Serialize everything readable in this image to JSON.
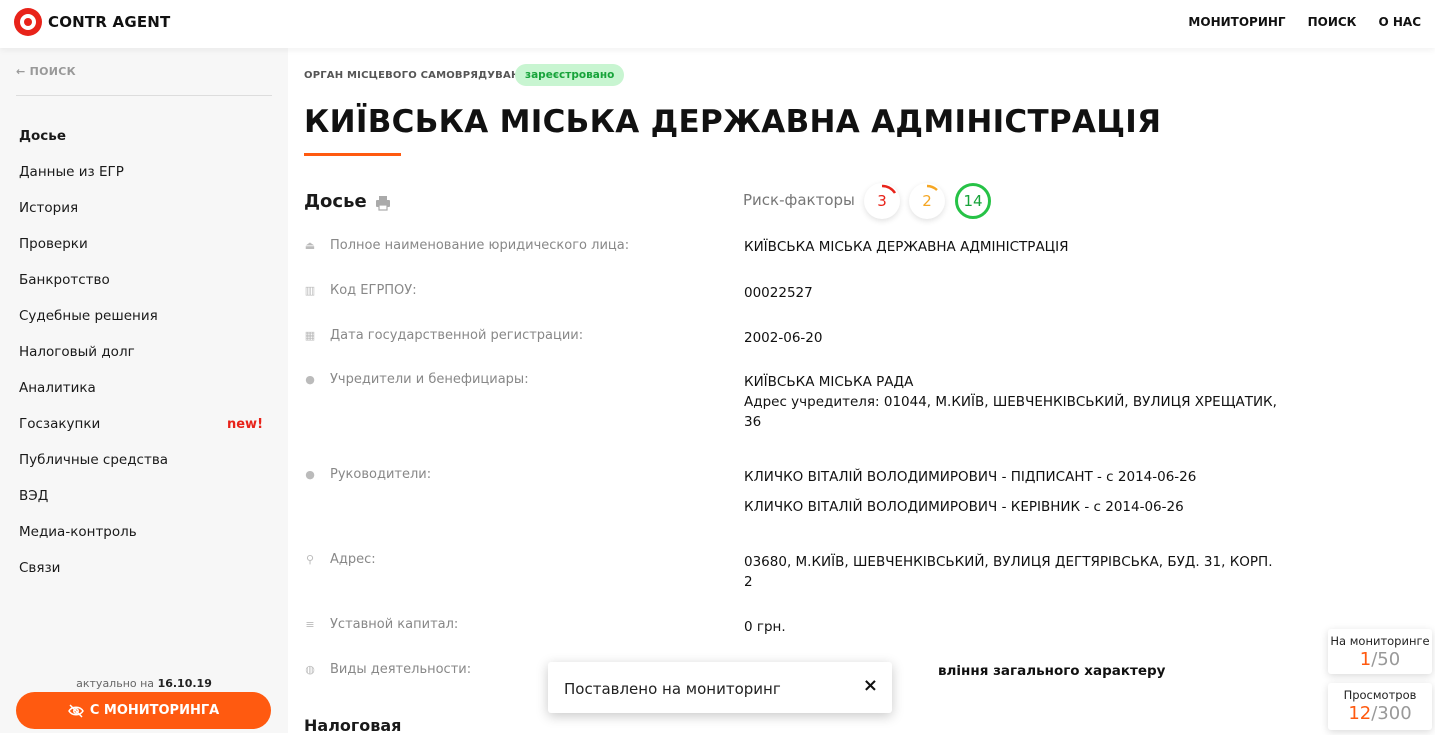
{
  "brand": {
    "name": "CONTR AGENT"
  },
  "topnav": [
    {
      "label": "МОНИТОРИНГ"
    },
    {
      "label": "ПОИСК"
    },
    {
      "label": "О НАС"
    }
  ],
  "sidebar": {
    "back_label": "← ПОИСК",
    "items": [
      {
        "label": "Досье",
        "active": true
      },
      {
        "label": "Данные из ЕГР"
      },
      {
        "label": "История"
      },
      {
        "label": "Проверки"
      },
      {
        "label": "Банкротство"
      },
      {
        "label": "Судебные решения"
      },
      {
        "label": "Налоговый долг"
      },
      {
        "label": "Аналитика"
      },
      {
        "label": "Госзакупки",
        "badge": "new!"
      },
      {
        "label": "Публичные средства"
      },
      {
        "label": "ВЭД"
      },
      {
        "label": "Медиа-контроль"
      },
      {
        "label": "Связи"
      }
    ],
    "actual_prefix": "актуально на",
    "actual_date": "16.10.19",
    "monitor_button": "С МОНИТОРИНГА"
  },
  "header": {
    "org_type": "ОРГАН МІСЦЕВОГО САМОВРЯДУВАННЯ",
    "status": "зареєстровано",
    "title": "КИЇВСЬКА МІСЬКА ДЕРЖАВНА АДМІНІСТРАЦІЯ"
  },
  "dossier": {
    "section_title": "Досье",
    "risk_label": "Риск-факторы",
    "risks": {
      "red": "3",
      "orange": "2",
      "green": "14"
    },
    "colors": {
      "red": "#e8231a",
      "orange": "#f5a623",
      "green": "#26c246",
      "accent": "#ff5a10"
    },
    "rows": [
      {
        "icon": "name-icon",
        "label": "Полное наименование юридического лица:",
        "values": [
          "КИЇВСЬКА МІСЬКА ДЕРЖАВНА АДМІНІСТРАЦІЯ"
        ]
      },
      {
        "icon": "barcode-icon",
        "label": "Код ЕГРПОУ:",
        "values": [
          "00022527"
        ]
      },
      {
        "icon": "calendar-icon",
        "label": "Дата государственной регистрации:",
        "values": [
          "2002-06-20"
        ]
      },
      {
        "icon": "user-icon",
        "label": "Учредители и бенефициары:",
        "values": [
          "КИЇВСЬКА МІСЬКА РАДА",
          "Адрес учредителя: 01044, М.КИЇВ, ШЕВЧЕНКІВСЬКИЙ, ВУЛИЦЯ ХРЕЩАТИК, 36"
        ]
      },
      {
        "icon": "user-icon",
        "label": "Руководители:",
        "values": [
          "КЛИЧКО ВІТАЛІЙ ВОЛОДИМИРОВИЧ - ПІДПИСАНТ - с 2014-06-26",
          "КЛИЧКО ВІТАЛІЙ ВОЛОДИМИРОВИЧ - КЕРІВНИК - с 2014-06-26"
        ]
      },
      {
        "icon": "pin-icon",
        "label": "Адрес:",
        "values": [
          "03680, М.КИЇВ, ШЕВЧЕНКІВСЬКИЙ, ВУЛИЦЯ ДЕГТЯРІВСЬКА, БУД. 31, КОРП. 2"
        ]
      },
      {
        "icon": "coins-icon",
        "label": "Уставной капитал:",
        "values": [
          "0 грн."
        ]
      },
      {
        "icon": "globe-icon",
        "label": "Виды деятельности:",
        "values": [
          "вління загального характеру"
        ]
      }
    ]
  },
  "bottom_section": "Налоговая",
  "toast": {
    "text": "Поставлено на мониторинг",
    "close": "×"
  },
  "stats": {
    "monitoring_label": "На мониторинге",
    "monitoring_current": "1",
    "monitoring_total": "/50",
    "views_label": "Просмотров",
    "views_current": "12",
    "views_total": "/300"
  }
}
